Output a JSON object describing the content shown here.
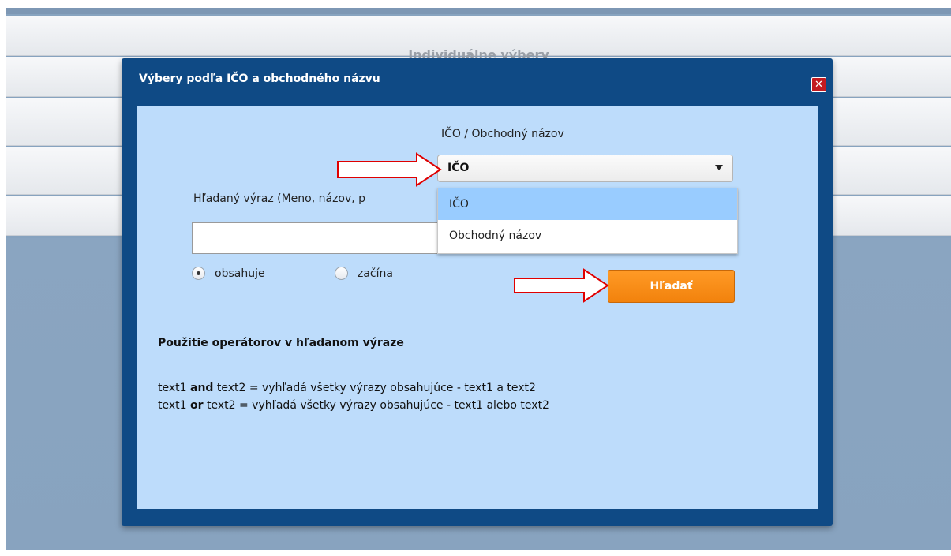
{
  "background": {
    "title": "Individuálne výbery"
  },
  "dialog": {
    "title": "Výbery podľa IČO a obchodného názvu",
    "close_icon": "close-icon",
    "type_label": "IČO / Obchodný názov",
    "type_select": {
      "value": "IČO",
      "options": [
        "IČO",
        "Obchodný názov"
      ],
      "highlighted": "IČO"
    },
    "search_label": "Hľadaný výraz (Meno, názov, p",
    "search_input": {
      "value": ""
    },
    "radio": {
      "contains_label": "obsahuje",
      "starts_label": "začína",
      "selected": "obsahuje"
    },
    "search_button_label": "Hľadať",
    "operators": {
      "heading": "Použitie operátorov v hľadanom výraze",
      "and_line": {
        "t1": "text1",
        "op": "and",
        "rest": "text2 = vyhľadá všetky výrazy obsahujúce - text1 a text2"
      },
      "or_line": {
        "t1": "text1",
        "op": "or",
        "rest": "text2 = vyhľadá všetky výrazy obsahujúce - text1 alebo text2"
      }
    }
  },
  "colors": {
    "dialog_frame": "#0f4a85",
    "content_bg": "#bddcfb",
    "button_orange": "#f7891a",
    "annotation_arrow": "#e00000"
  }
}
